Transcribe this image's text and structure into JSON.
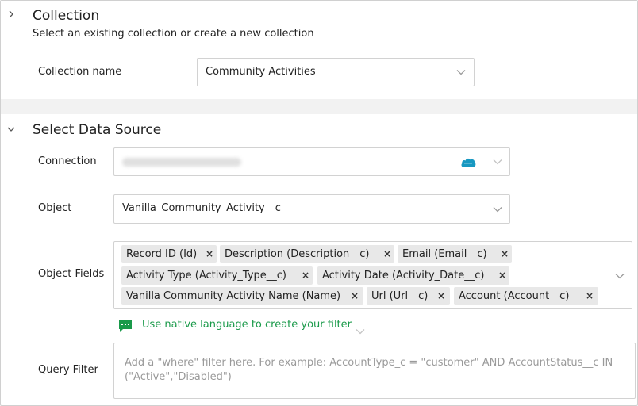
{
  "collection": {
    "title": "Collection",
    "subtitle": "Select an existing collection or create a new collection",
    "name_label": "Collection name",
    "name_value": "Community Activities",
    "expand_icon": "chevron-right-icon"
  },
  "data_source": {
    "title": "Select Data Source",
    "collapse_icon": "chevron-down-icon",
    "connection_label": "Connection",
    "connection_icon": "salesforce-cloud-icon",
    "object_label": "Object",
    "object_value": "Vanilla_Community_Activity__c",
    "fields_label": "Object Fields",
    "fields": [
      "Record ID (Id)",
      "Description (Description__c)",
      "Email (Email__c)",
      "Activity Type (Activity_Type__c)",
      "Activity Date (Activity_Date__c)",
      "Vanilla Community Activity Name (Name)",
      "Url (Url__c)",
      "Account (Account__c)"
    ],
    "remove_glyph": "×",
    "native_language_text": "Use native language to create your filter",
    "query_label": "Query Filter",
    "query_placeholder": "Add a \"where\" filter here. For example: AccountType_c = \"customer\" AND AccountStatus__c IN (\"Active\",\"Disabled\")"
  },
  "colors": {
    "accent_green": "#1a9a4a",
    "salesforce_blue": "#1798c1"
  }
}
